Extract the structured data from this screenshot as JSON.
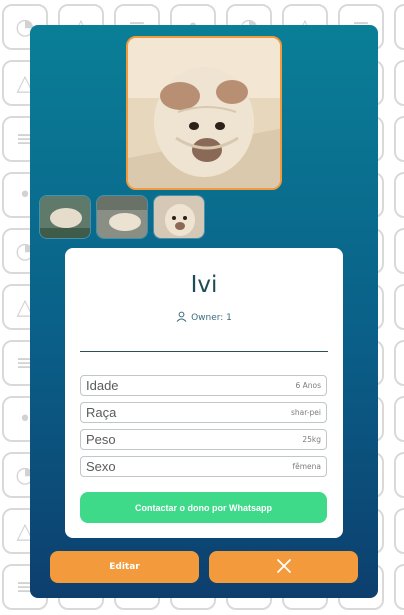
{
  "pet": {
    "name": "Ivi",
    "owner_label": "Owner: 1"
  },
  "fields": [
    {
      "label": "Idade",
      "value": "6 Anos"
    },
    {
      "label": "Raça",
      "value": "shar-pei"
    },
    {
      "label": "Peso",
      "value": "25kg"
    },
    {
      "label": "Sexo",
      "value": "fêmena"
    }
  ],
  "actions": {
    "whatsapp_label": "Contactar o dono por Whatsapp",
    "edit_label": "Editar",
    "close_icon": "close-icon"
  },
  "colors": {
    "card_gradient_top": "#0a7f97",
    "card_gradient_bottom": "#0d3f6e",
    "accent_orange": "#f39a3c",
    "whatsapp_green": "#3fd98a"
  },
  "icons": {
    "owner_icon": "user-icon",
    "background_icons": [
      "dog-icon",
      "cat-icon",
      "bone-icon",
      "paw-icon"
    ]
  }
}
